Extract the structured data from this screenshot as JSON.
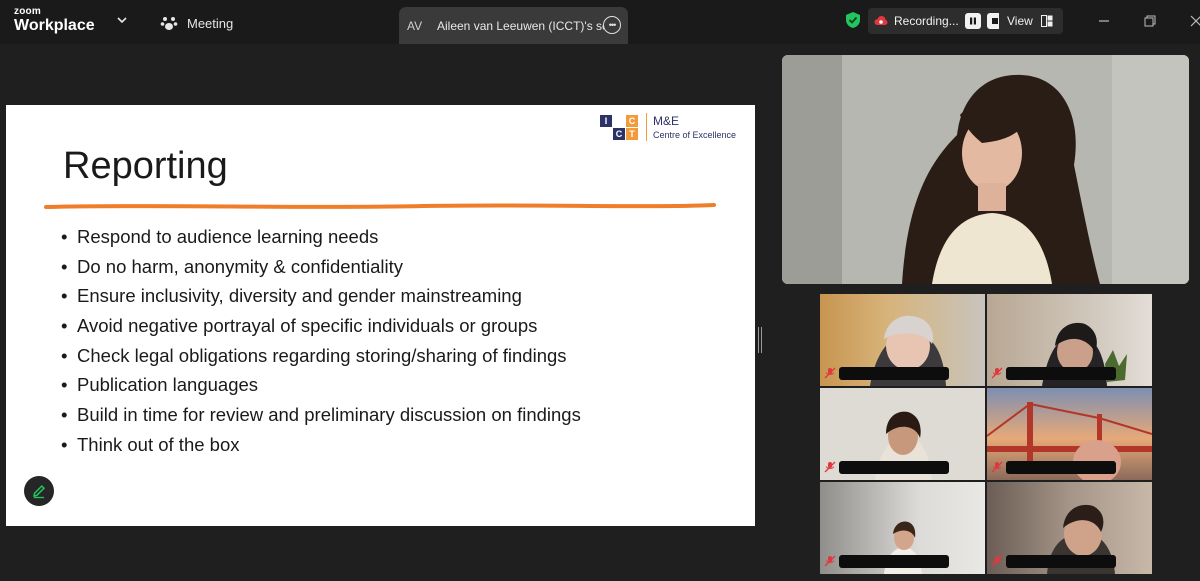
{
  "app": {
    "brand_top": "zoom",
    "brand_bottom": "Workplace",
    "meeting_label": "Meeting",
    "share_tab": {
      "initials": "AV",
      "title": "Aileen van Leeuwen (ICCT)'s scree"
    },
    "recording_label": "Recording...",
    "view_label": "View"
  },
  "slide": {
    "title": "Reporting",
    "bullets": [
      "Respond to audience learning needs",
      "Do no harm, anonymity & confidentiality",
      "Ensure inclusivity, diversity and gender mainstreaming",
      "Avoid negative portrayal of specific individuals or groups",
      "Check legal obligations regarding storing/sharing of findings",
      "Publication languages",
      "Build in time for review and preliminary discussion on findings",
      "Think out of the box"
    ],
    "logo": {
      "letters": [
        "I",
        "C",
        "C",
        "T"
      ],
      "line1": "M&E",
      "line2": "Centre of Excellence"
    },
    "bullet_symbol": "•"
  },
  "colors": {
    "orange_rule": "#ef7d2a",
    "logo_navy": "#2c3266",
    "logo_orange": "#f39a3a",
    "secure_green": "#22c55e",
    "muted_red": "#e0383e"
  }
}
